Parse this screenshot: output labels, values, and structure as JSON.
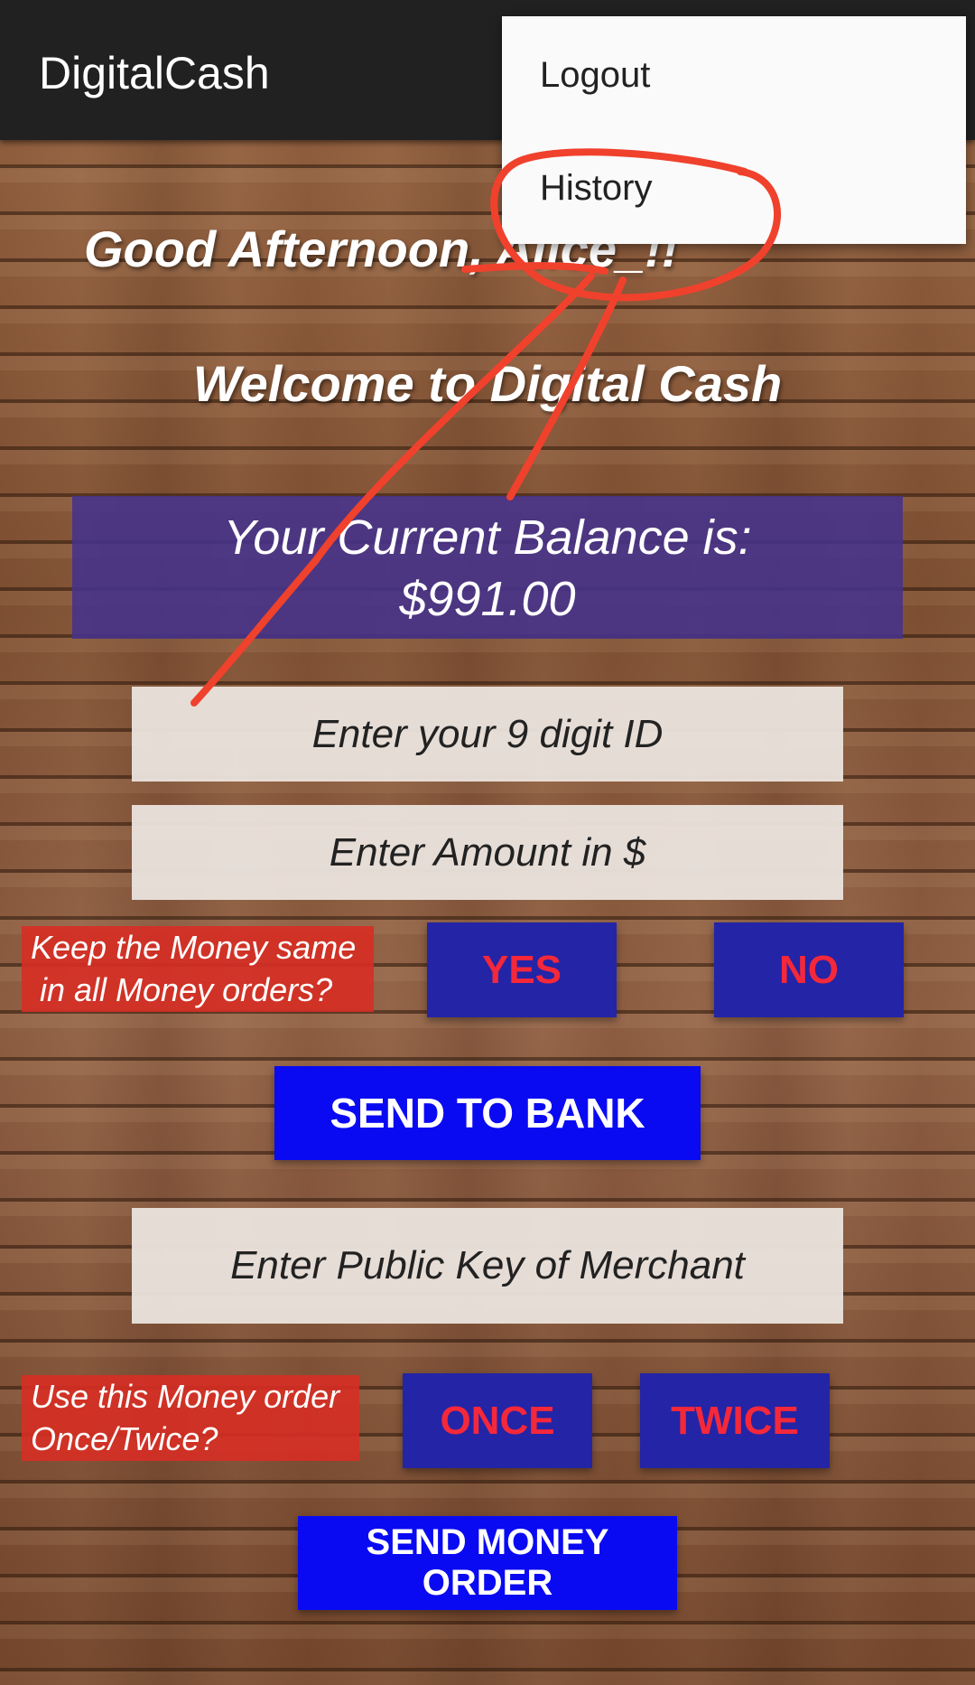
{
  "app": {
    "title": "DigitalCash"
  },
  "menu": {
    "items": [
      {
        "label": "Logout"
      },
      {
        "label": "History"
      }
    ]
  },
  "greeting": "Good Afternoon, Alice_!!",
  "welcome": "Welcome to Digital Cash",
  "balance": {
    "label": "Your Current Balance is:",
    "amount": "$991.00"
  },
  "fields": {
    "id_placeholder": "Enter your 9 digit ID",
    "amount_placeholder": "Enter Amount in $",
    "merchant_key_placeholder": "Enter Public Key of Merchant"
  },
  "same_money": {
    "prompt_line1": "Keep the Money same",
    "prompt_line2": "in all Money orders?",
    "yes": "YES",
    "no": "NO"
  },
  "send_to_bank": "SEND TO BANK",
  "use_order": {
    "prompt_line1": "Use this Money order",
    "prompt_line2": "Once/Twice?",
    "once": "ONCE",
    "twice": "TWICE"
  },
  "send_money_order": "SEND MONEY ORDER",
  "colors": {
    "appbar": "#212121",
    "balance_box": "#46328c",
    "choice_button": "#2424a6",
    "choice_text": "#f5283a",
    "action_button": "#0a0af2",
    "prompt_box": "#d72d23",
    "annotation": "#f0412d"
  },
  "icons": {
    "annotation": "red-circle-arrow-annotation"
  }
}
